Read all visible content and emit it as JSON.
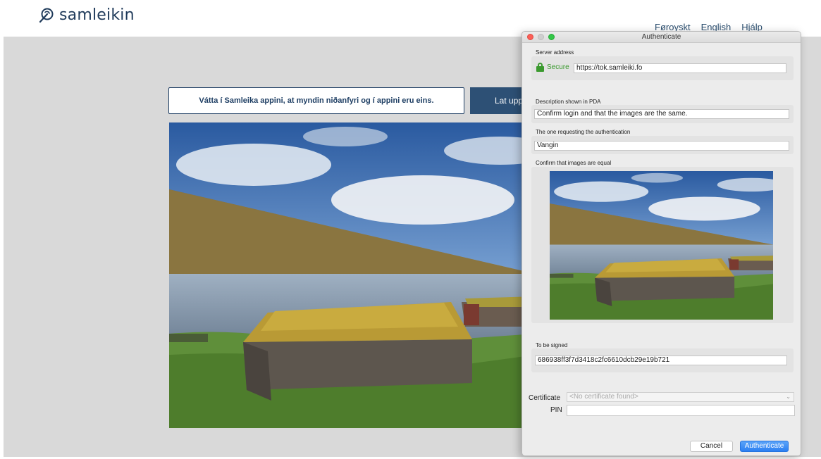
{
  "header": {
    "logo_text": "samleikin",
    "languages": [
      "Føroyskt",
      "English"
    ],
    "help_label": "Hjálp"
  },
  "main": {
    "instruction": "Vátta í Samleika appini, at myndin niðanfyri og í appini eru eins.",
    "upload_label": "Lat upp"
  },
  "dialog": {
    "title": "Authenticate",
    "server_address_label": "Server address",
    "secure_label": "Secure",
    "server_url": "https://tok.samleiki.fo",
    "description_label": "Description shown in PDA",
    "description_value": "Confirm login and that the images are the same.",
    "requester_label": "The one requesting the authentication",
    "requester_value": "Vangin",
    "images_label": "Confirm that images are equal",
    "to_sign_label": "To be signed",
    "to_sign_value": "686938ff3f7d3418c2fc6610dcb29e19b721",
    "certificate_label": "Certificate",
    "certificate_placeholder": "<No certificate found>",
    "pin_label": "PIN",
    "cancel_label": "Cancel",
    "authenticate_label": "Authenticate"
  },
  "icons": {
    "logo": "samleikin-logo-icon",
    "lock": "lock-icon",
    "chevron": "chevron-down-icon"
  },
  "colors": {
    "brand": "#1f3a5a",
    "secure_green": "#3b9a2f",
    "primary_button": "#2b7ff2"
  }
}
